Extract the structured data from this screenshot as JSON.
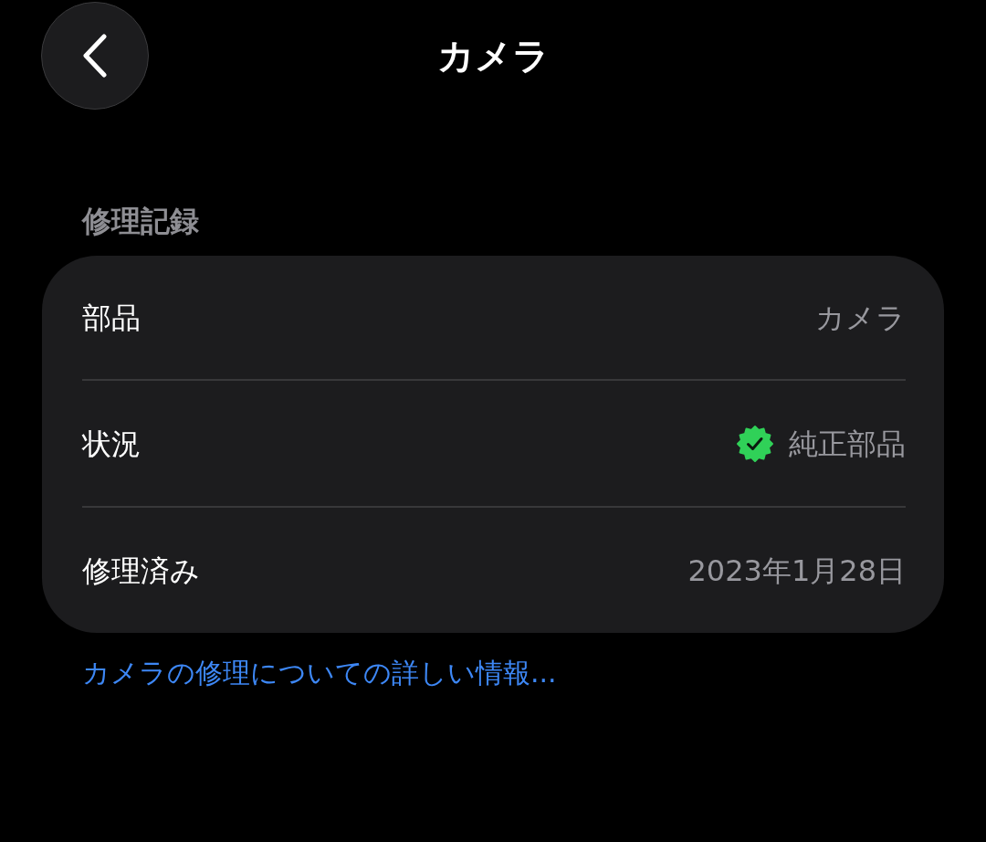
{
  "header": {
    "title": "カメラ"
  },
  "section": {
    "title": "修理記録"
  },
  "rows": [
    {
      "label": "部品",
      "value": "カメラ",
      "verified": false
    },
    {
      "label": "状況",
      "value": "純正部品",
      "verified": true
    },
    {
      "label": "修理済み",
      "value": "2023年1月28日",
      "verified": false
    }
  ],
  "link": {
    "text": "カメラの修理についての詳しい情報..."
  }
}
